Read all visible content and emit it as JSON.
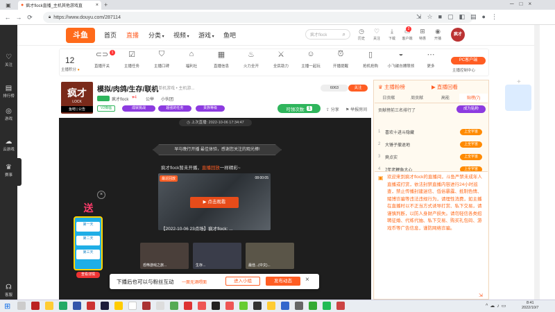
{
  "browser": {
    "tab_title": "疯才flock直播_主机其他游戏直",
    "url": "https://www.douyu.com/287114"
  },
  "dock": [
    {
      "label": "关注",
      "icon": "heart-icon"
    },
    {
      "label": "排行榜",
      "icon": "ranking-icon"
    },
    {
      "label": "游戏",
      "icon": "gamepad-icon"
    },
    {
      "label": "云游戏",
      "icon": "cloud-game-icon"
    },
    {
      "label": "赛事",
      "icon": "trophy-icon"
    },
    {
      "label": "客服",
      "icon": "headset-icon"
    }
  ],
  "header": {
    "logo_text": "斗鱼",
    "nav": [
      "首页",
      "直播",
      "分类",
      "视频",
      "游戏",
      "鱼吧"
    ],
    "nav_active": "直播",
    "search_placeholder": "疯才flock",
    "icons": [
      {
        "label": "历史",
        "icon": "clock-icon"
      },
      {
        "label": "关注",
        "icon": "heart-icon"
      },
      {
        "label": "下载",
        "icon": "download-icon"
      },
      {
        "label": "客户端",
        "icon": "client-icon",
        "badge": "2"
      },
      {
        "label": "特惠",
        "icon": "gift-icon"
      },
      {
        "label": "开播",
        "icon": "broadcast-icon"
      }
    ],
    "avatar_text": "疯才"
  },
  "toolbar": {
    "level": "12",
    "level_label": "主播积分",
    "tools": [
      {
        "label": "直播开关",
        "icon": "toggle-icon",
        "badge": "1"
      },
      {
        "label": "主播任务",
        "icon": "task-icon"
      },
      {
        "label": "主播口碑",
        "icon": "shield-icon"
      },
      {
        "label": "福利社",
        "icon": "gift-box-icon"
      },
      {
        "label": "直播信息",
        "icon": "info-icon"
      },
      {
        "label": "火力全开",
        "icon": "fire-icon"
      },
      {
        "label": "全民助力",
        "icon": "pk-icon"
      },
      {
        "label": "主播一起玩",
        "icon": "play-icon"
      },
      {
        "label": "开播提醒",
        "icon": "alarm-icon"
      },
      {
        "label": "抢机抢购",
        "icon": "phone-icon"
      },
      {
        "label": "小飞碟白嫖限领",
        "icon": "ufo-icon"
      },
      {
        "label": "更多",
        "icon": "more-icon"
      }
    ],
    "pc_button": "PC客户端",
    "pc_sub": "主播控制中心"
  },
  "room": {
    "avatar_text": "疯才",
    "avatar_sub": "LOCK",
    "avatar_tag": "鱼吧 | 公告",
    "title": "模拟/肉鸽/生存/联机",
    "category": "单机游戏 • 主机游...",
    "host_tag": "疯才flock",
    "host_level": "4",
    "share_hint": "公举",
    "room_extra": "小伙团",
    "badges": [
      "V2降临",
      "成就挑战",
      "超强的任务",
      "贵族等级"
    ],
    "follow_count": "6063",
    "follow_label": "关注",
    "watch_label": "可领次数:",
    "watch_value": "1",
    "share": "分享",
    "report": "举报房间"
  },
  "video": {
    "last_live": "上次直播: 2022-10-06 17:34:47",
    "banner": "早与晚行开播 最佳体验，感谢您关注的观光棒!",
    "offline_msg": "疯才flock暂未开播，",
    "offline_link": "直播回放",
    "offline_tail": "一样精彩~",
    "replay_tag": "最近回放",
    "replay_duration": "08:00:05",
    "watch_button": "点击观看",
    "replay_title": "【2022-10-06 23点场】疯才flock: ...",
    "thumbs": [
      "恐怖游戏之旅...",
      "生存...",
      "最佳...(中文)..."
    ],
    "interact_text": "下播后也可以与粉丝互动",
    "interact_link": "一面无酒喂面",
    "interact_btn1": "进入小组",
    "interact_btn2": "发布动态",
    "gift_title": "送",
    "gift_rows": [
      "第一天",
      "第二天",
      "第三天"
    ],
    "gift_link": "查看详情"
  },
  "rpanel": {
    "tabs_top": [
      "主播粉榜",
      "直播回看"
    ],
    "tabs": [
      "日贡献",
      "周贡献",
      "高能",
      "贴榜(7)"
    ],
    "rank_title": "贡献榜前三名排行了",
    "rank_btn": "成为贴粉",
    "ranks": [
      {
        "n": "1",
        "name": "喜欢十进斗隐藏"
      },
      {
        "n": "2",
        "name": "大锤子撤退地"
      },
      {
        "n": "3",
        "name": "爽点实"
      },
      {
        "n": "4",
        "name": "7年老鲤鱼大心"
      }
    ],
    "rank_action": "上全宇宙",
    "notice": "欢迎来到疯才flock的直播间，斗鱼严禁未成年人直播或打赏，依法封禁直播内容进行24小时巡查，禁止传播封建迷信、低俗暴露、抵制色情、赌博诈骗等违法违规行为，请理性消费，如主播在直播时以不正当方式诱导打赏、私下交易，请谨慎判断，以防人身财产损失。请勿轻信各类招聘征婚、代练代抽、私下交易、购买礼包码、游戏币等广告信息，谨防网络诈骗。"
  },
  "taskbar": {
    "time": "8:41",
    "date": "2022/10/7"
  },
  "colors": {
    "accent": "#ff5d23",
    "orange": "#ff8a00",
    "purple": "#8c3be0",
    "green": "#2fb55c",
    "dark": "#1e1e1e"
  }
}
